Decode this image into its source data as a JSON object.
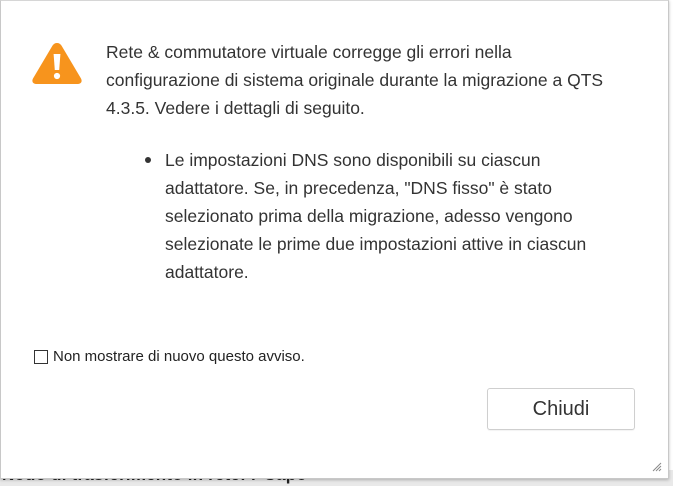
{
  "background": {
    "partial_text": "Nodo di trasferimento in rete: r-Capo"
  },
  "dialog": {
    "icon": "warning-triangle-icon",
    "icon_color": "#f7941d",
    "message": "Rete & commutatore virtuale corregge gli errori nella configurazione di sistema originale durante la migrazione a QTS 4.3.5. Vedere i dettagli di seguito.",
    "details": [
      "Le impostazioni DNS sono disponibili su ciascun adattatore. Se, in precedenza, \"DNS fisso\" è stato selezionato prima della migrazione, adesso vengono selezionate le prime due impostazioni attive in ciascun adattatore."
    ],
    "checkbox": {
      "label": "Non mostrare di nuovo questo avviso.",
      "checked": false
    },
    "close_button_label": "Chiudi"
  }
}
